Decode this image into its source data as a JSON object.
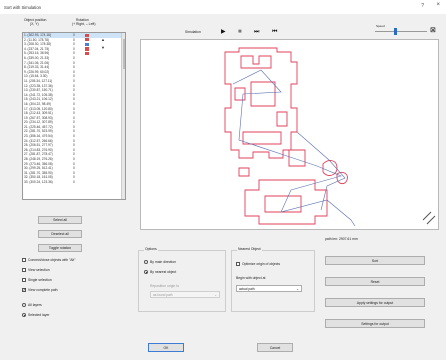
{
  "window": {
    "title": "Sort with Simulation",
    "help": "?",
    "close": "×"
  },
  "list": {
    "header_col1": "Object position",
    "header_col1_sub": "(X, Y)",
    "header_col2": "Rotation",
    "header_col2_sub": "(+ Right, – Left)",
    "rows": [
      {
        "pos": "1. (302.93, 174.16)",
        "rot": "0",
        "color": "#d94c4c"
      },
      {
        "pos": "2. (11.50, 178.78)",
        "rot": "0",
        "color": "#d94c4c"
      },
      {
        "pos": "3. (208.30, 178.38)",
        "rot": "0",
        "color": "#4a7fd6"
      },
      {
        "pos": "4. (237.04, 21.75)",
        "rot": "0",
        "color": "#d94c4c"
      },
      {
        "pos": "5. (253.16, 36.96)",
        "rot": "0",
        "color": "#d94c4c"
      },
      {
        "pos": "6. (339.00, 21.33)",
        "rot": "0",
        "color": "#d94c4c"
      },
      {
        "pos": "7. (341.06, 21.06)",
        "rot": "0",
        "color": "#d94c4c"
      },
      {
        "pos": "8. (219.33, 31.44)",
        "rot": "0",
        "color": "#d94c4c"
      },
      {
        "pos": "9. (226.99, 60.02)",
        "rot": "0",
        "color": "#d94c4c"
      },
      {
        "pos": "10. (15.64, 3.30)",
        "rot": "0",
        "color": "#d94c4c"
      },
      {
        "pos": "11. (205.34, 127.11)",
        "rot": "0",
        "color": "#d94c4c"
      },
      {
        "pos": "12. (223.35, 137.36)",
        "rot": "0",
        "color": "#d94c4c"
      },
      {
        "pos": "13. (230.87, 150.71)",
        "rot": "0",
        "color": "#d94c4c"
      },
      {
        "pos": "14. (241.72, 105.38)",
        "rot": "0",
        "color": "#d94c4c"
      },
      {
        "pos": "15. (243.21, 106.12)",
        "rot": "0",
        "color": "#d94c4c"
      },
      {
        "pos": "16. (304.22, 98.49)",
        "rot": "0",
        "color": "#d94c4c"
      },
      {
        "pos": "17. (313.05, 120.80)",
        "rot": "0",
        "color": "#d94c4c"
      },
      {
        "pos": "18. (212.43, 309.51)",
        "rot": "0",
        "color": "#d94c4c"
      },
      {
        "pos": "19. (267.57, 308.93)",
        "rot": "0",
        "color": "#d94c4c"
      },
      {
        "pos": "20. (234.12, 307.89)",
        "rot": "0",
        "color": "#d94c4c"
      },
      {
        "pos": "21. (225.46, 457.72)",
        "rot": "0",
        "color": "#d94c4c"
      },
      {
        "pos": "22. (281.70, 523.99)",
        "rot": "0",
        "color": "#d94c4c"
      },
      {
        "pos": "23. (356.16, 479.54)",
        "rot": "0",
        "color": "#d94c4c"
      },
      {
        "pos": "24. (312.57, 266.66)",
        "rot": "0",
        "color": "#d94c4c"
      },
      {
        "pos": "25. (206.51, 277.97)",
        "rot": "0",
        "color": "#d94c4c"
      },
      {
        "pos": "26. (214.83, 276.90)",
        "rot": "0",
        "color": "#d94c4c"
      },
      {
        "pos": "27. (281.87, 278.47)",
        "rot": "0",
        "color": "#d94c4c"
      },
      {
        "pos": "28. (248.19, 276.26)",
        "rot": "0",
        "color": "#d94c4c"
      },
      {
        "pos": "29. (273.46, 356.08)",
        "rot": "0",
        "color": "#d94c4c"
      },
      {
        "pos": "30. (299.25, 512.41)",
        "rot": "0",
        "color": "#d94c4c"
      },
      {
        "pos": "31. (281.70, 355.90)",
        "rot": "0",
        "color": "#d94c4c"
      },
      {
        "pos": "32. (350.18, 161.05)",
        "rot": "0",
        "color": "#d94c4c"
      },
      {
        "pos": "33. (300.24, 123.36)",
        "rot": "0",
        "color": "#d94c4c"
      }
    ]
  },
  "left_buttons": {
    "select_all": "Select all",
    "deselect_all": "Deselect all",
    "toggle_rotation": "Toggle rotation"
  },
  "left_checks": {
    "connect": "Connect/close objects with \"Alt\"",
    "view_selection": "View selection",
    "single_selection": "Single selection",
    "view_complete_path": "View complete path"
  },
  "layers": {
    "all": "All layers",
    "selected": "Selected layer"
  },
  "toolbar": {
    "simulation_label": "Simulation",
    "speed_label": "Speed"
  },
  "options": {
    "title": "Options",
    "by_main_direction": "By main direction",
    "by_nearest_object": "By nearest object",
    "reposition_label": "Reposition origin to",
    "reposition_value": "as-found path"
  },
  "nearest": {
    "title": "Nearest Object",
    "optimize_origin": "Optimize origin of objects",
    "begin_label": "Begin with object at",
    "begin_value": "actual path"
  },
  "path_length": "path len: 2907.61 mm",
  "right_buttons": {
    "sort": "Sort",
    "reset": "Reset",
    "apply_settings": "Apply settings for output",
    "settings_output": "Settings for output"
  },
  "footer": {
    "ok": "OK",
    "cancel": "Cancel"
  }
}
